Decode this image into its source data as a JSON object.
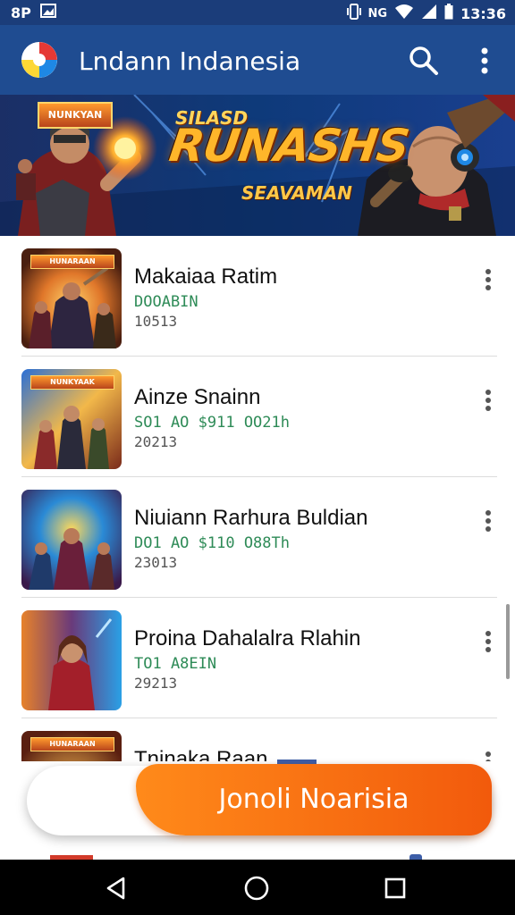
{
  "status_bar": {
    "left_text": "8P",
    "signal_text": "NG",
    "time": "13:36",
    "icons": [
      "image-icon",
      "vibrate-icon",
      "wifi-icon",
      "signal-icon",
      "battery-icon"
    ]
  },
  "app_bar": {
    "title": "Lndann Indanesia",
    "actions": [
      "search-icon",
      "more-vert-icon"
    ]
  },
  "banner": {
    "badge": "NUNKYAN",
    "super_title": "SILASD",
    "title": "RUNASHS",
    "subtitle": "SEAVAMAN"
  },
  "list": {
    "items": [
      {
        "thumb_label": "HUNARAAN",
        "title": "Makaiaa Ratim",
        "subtitle": "DOOABIN",
        "meta": "10513"
      },
      {
        "thumb_label": "NUNKYAAK",
        "title": "Ainze Snainn",
        "subtitle": "SO1 AO $911 OO21h",
        "meta": "20213"
      },
      {
        "thumb_label": "",
        "title": "Niuiann Rarhura Buldian",
        "subtitle": "DO1 AO $110 O88Th",
        "meta": "23013"
      },
      {
        "thumb_label": "",
        "title": "Proina Dahalalra Rlahin",
        "subtitle": "TO1 A8EIN",
        "meta": "29213"
      },
      {
        "thumb_label": "HUNARAAN",
        "title": "Tninaka Raan",
        "subtitle": "",
        "meta": ""
      }
    ]
  },
  "cta": {
    "label": "Jonoli Noarisia"
  },
  "colors": {
    "status_bar": "#1b3d7a",
    "app_bar": "#1f4c91",
    "accent_orange": "#f25a0c",
    "subtitle_green": "#2e8b57"
  },
  "nav_bar": {
    "buttons": [
      "back-icon",
      "home-icon",
      "recents-icon"
    ]
  }
}
